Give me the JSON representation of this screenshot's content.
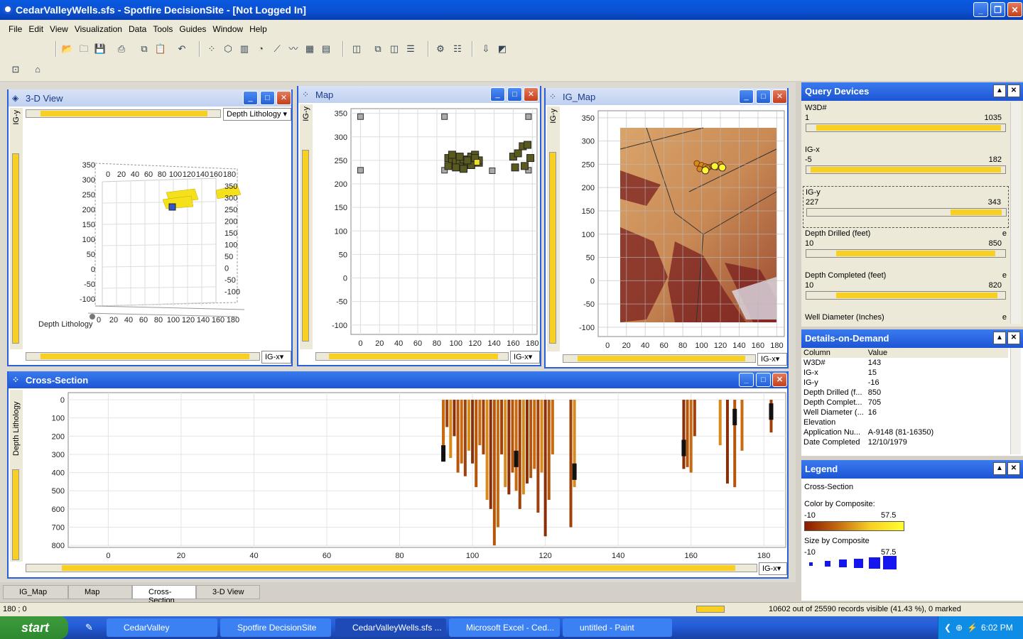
{
  "window": {
    "title": "CedarValleyWells.sfs - Spotfire DecisionSite - [Not Logged In]"
  },
  "menu": [
    "File",
    "Edit",
    "View",
    "Visualization",
    "Data",
    "Tools",
    "Guides",
    "Window",
    "Help"
  ],
  "views": {
    "view3d": {
      "title": "3-D View",
      "color_dropdown": "Depth Lithology",
      "y_axis": "IG-y",
      "x_axis_dropdown": "IG-x",
      "z_label": "Depth Lithology",
      "z_ticks": [
        "350",
        "300",
        "250",
        "200",
        "150",
        "100",
        "50",
        "0",
        "-50",
        "-100"
      ],
      "x_ticks": [
        "0",
        "20",
        "40",
        "60",
        "80",
        "100",
        "120",
        "140",
        "160",
        "180"
      ],
      "top_ticks": [
        "0",
        "20",
        "40",
        "60",
        "80",
        "100",
        "120",
        "140",
        "160",
        "180"
      ],
      "right_ticks": [
        "350",
        "300",
        "250",
        "200",
        "150",
        "100",
        "50",
        "0",
        "-50",
        "-100"
      ]
    },
    "map": {
      "title": "Map",
      "y_axis": "IG-y",
      "x_axis_dropdown": "IG-x",
      "y_ticks": [
        "350",
        "300",
        "250",
        "200",
        "150",
        "100",
        "50",
        "0",
        "-50",
        "-100"
      ],
      "x_ticks": [
        "0",
        "20",
        "40",
        "60",
        "80",
        "100",
        "120",
        "140",
        "160",
        "180"
      ]
    },
    "igmap": {
      "title": "IG_Map",
      "y_axis": "IG-y",
      "x_axis_dropdown": "IG-x",
      "y_ticks": [
        "350",
        "300",
        "250",
        "200",
        "150",
        "100",
        "50",
        "0",
        "-50",
        "-100"
      ],
      "x_ticks": [
        "0",
        "20",
        "40",
        "60",
        "80",
        "100",
        "120",
        "140",
        "160",
        "180"
      ]
    },
    "cross": {
      "title": "Cross-Section",
      "y_axis": "Depth Lithology",
      "x_axis_dropdown": "IG-x",
      "y_ticks": [
        "0",
        "100",
        "200",
        "300",
        "400",
        "500",
        "600",
        "700",
        "800"
      ],
      "x_ticks": [
        "0",
        "20",
        "40",
        "60",
        "80",
        "100",
        "120",
        "140",
        "160",
        "180"
      ]
    }
  },
  "query_devices": {
    "title": "Query Devices",
    "items": [
      {
        "name": "W3D#",
        "low": "1",
        "high": "1035",
        "fill": [
          0.05,
          0.98
        ]
      },
      {
        "name": "IG-x",
        "low": "-5",
        "high": "182",
        "fill": [
          0.02,
          0.98
        ]
      },
      {
        "name": "IG-y",
        "low": "227",
        "high": "343",
        "fill": [
          0.72,
          0.98
        ]
      },
      {
        "name": "Depth Drilled (feet)",
        "low": "10",
        "high": "850",
        "fill": [
          0.15,
          0.95
        ],
        "flag": "e"
      },
      {
        "name": "Depth Completed (feet)",
        "low": "10",
        "high": "820",
        "fill": [
          0.15,
          0.96
        ],
        "flag": "e"
      },
      {
        "name": "Well Diameter (Inches)",
        "low": "",
        "high": "",
        "fill": [
          0,
          0
        ],
        "flag": "e"
      }
    ]
  },
  "details": {
    "title": "Details-on-Demand",
    "col_header": "Column",
    "val_header": "Value",
    "rows": [
      [
        "W3D#",
        "143"
      ],
      [
        "IG-x",
        "15"
      ],
      [
        "IG-y",
        "-16"
      ],
      [
        "Depth Drilled (f...",
        "850"
      ],
      [
        "Depth Complet...",
        "705"
      ],
      [
        "Well Diameter (...",
        "16"
      ],
      [
        "Elevation",
        ""
      ],
      [
        "Application Nu...",
        "A-9148 (81-16350)"
      ],
      [
        "Date Completed",
        "12/10/1979"
      ]
    ]
  },
  "legend": {
    "title": "Legend",
    "view": "Cross-Section",
    "color_label": "Color by Composite:",
    "color_min": "-10",
    "color_max": "57.5",
    "size_label": "Size by Composite",
    "size_min": "-10",
    "size_max": "57.5"
  },
  "tabs": [
    "IG_Map",
    "Map",
    "Cross-Section",
    "3-D View"
  ],
  "status": {
    "coords": "180 ; 0",
    "records": "10602 out of 25590 records visible (41.43 %), 0 marked"
  },
  "taskbar": {
    "start": "start",
    "tasks": [
      "CedarValley",
      "Spotfire DecisionSite",
      "CedarValleyWells.sfs ...",
      "Microsoft Excel - Ced...",
      "untitled - Paint"
    ],
    "time": "6:02 PM"
  },
  "chart_data": [
    {
      "type": "scatter",
      "view": "Map",
      "x_range": [
        -10,
        185
      ],
      "y_range": [
        -120,
        360
      ],
      "series": [
        {
          "x": [
            0,
            0,
            88,
            88,
            176,
            176,
            138
          ],
          "y": [
            343,
            229,
            343,
            229,
            343,
            229,
            228
          ]
        },
        {
          "x": [
            92,
            96,
            100,
            104,
            108,
            112,
            116,
            120,
            124,
            92,
            100,
            108,
            116,
            124,
            96,
            104,
            112,
            120,
            160,
            165,
            170,
            175,
            178,
            162,
            172
          ],
          "y": [
            255,
            250,
            248,
            245,
            252,
            240,
            258,
            262,
            245,
            238,
            235,
            232,
            240,
            250,
            262,
            258,
            250,
            255,
            258,
            265,
            280,
            283,
            255,
            235,
            238
          ]
        }
      ]
    },
    {
      "type": "bar",
      "view": "Cross-Section",
      "x_range": [
        -11,
        186
      ],
      "y_range": [
        0,
        850
      ],
      "note": "depth of each well column",
      "x": [
        92,
        92,
        93,
        94,
        95,
        96,
        97,
        98,
        99,
        100,
        101,
        102,
        103,
        104,
        105,
        106,
        107,
        108,
        109,
        110,
        111,
        112,
        113,
        114,
        115,
        116,
        117,
        118,
        119,
        120,
        121,
        122,
        127,
        128,
        158,
        159,
        160,
        161,
        168,
        170,
        172,
        174,
        182
      ],
      "values": [
        220,
        320,
        150,
        320,
        200,
        400,
        350,
        420,
        280,
        350,
        480,
        250,
        300,
        550,
        600,
        800,
        700,
        300,
        480,
        520,
        400,
        500,
        600,
        520,
        460,
        430,
        380,
        620,
        400,
        750,
        550,
        300,
        700,
        480,
        380,
        370,
        400,
        200,
        250,
        460,
        480,
        280,
        180
      ]
    }
  ]
}
